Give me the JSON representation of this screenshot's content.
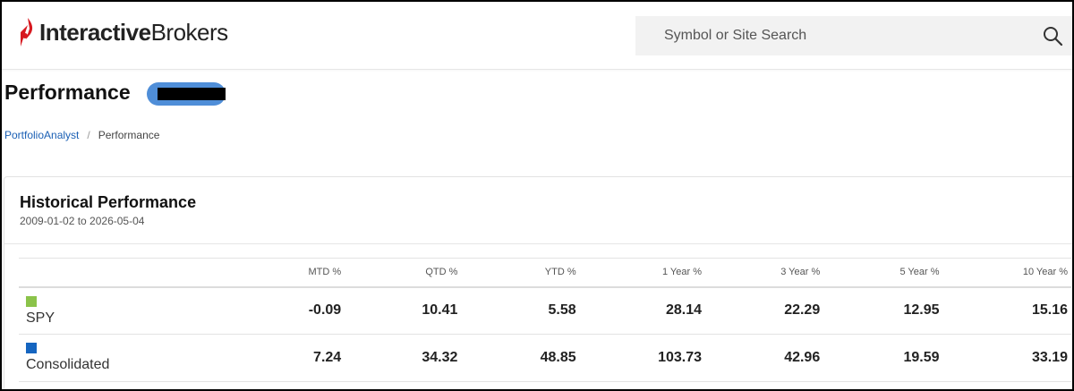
{
  "header": {
    "logo": {
      "bold": "Interactive",
      "light": "Brokers",
      "mark_color": "#d71920"
    },
    "search": {
      "placeholder": "Symbol or Site Search",
      "icon": "search-icon"
    }
  },
  "page": {
    "title": "Performance",
    "account_pill_color": "#4f8ed8"
  },
  "breadcrumb": {
    "link": "PortfolioAnalyst",
    "separator": "/",
    "current": "Performance"
  },
  "card": {
    "title": "Historical Performance",
    "date_range": "2009-01-02 to 2026-05-04"
  },
  "table": {
    "columns": [
      "",
      "MTD %",
      "QTD %",
      "YTD %",
      "1 Year %",
      "3 Year %",
      "5 Year %",
      "10 Year %"
    ],
    "rows": [
      {
        "name": "SPY",
        "color": "#8bc34a",
        "values": [
          "-0.09",
          "10.41",
          "5.58",
          "28.14",
          "22.29",
          "12.95",
          "15.16"
        ]
      },
      {
        "name": "Consolidated",
        "color": "#1565c0",
        "values": [
          "7.24",
          "34.32",
          "48.85",
          "103.73",
          "42.96",
          "19.59",
          "33.19"
        ]
      }
    ]
  }
}
